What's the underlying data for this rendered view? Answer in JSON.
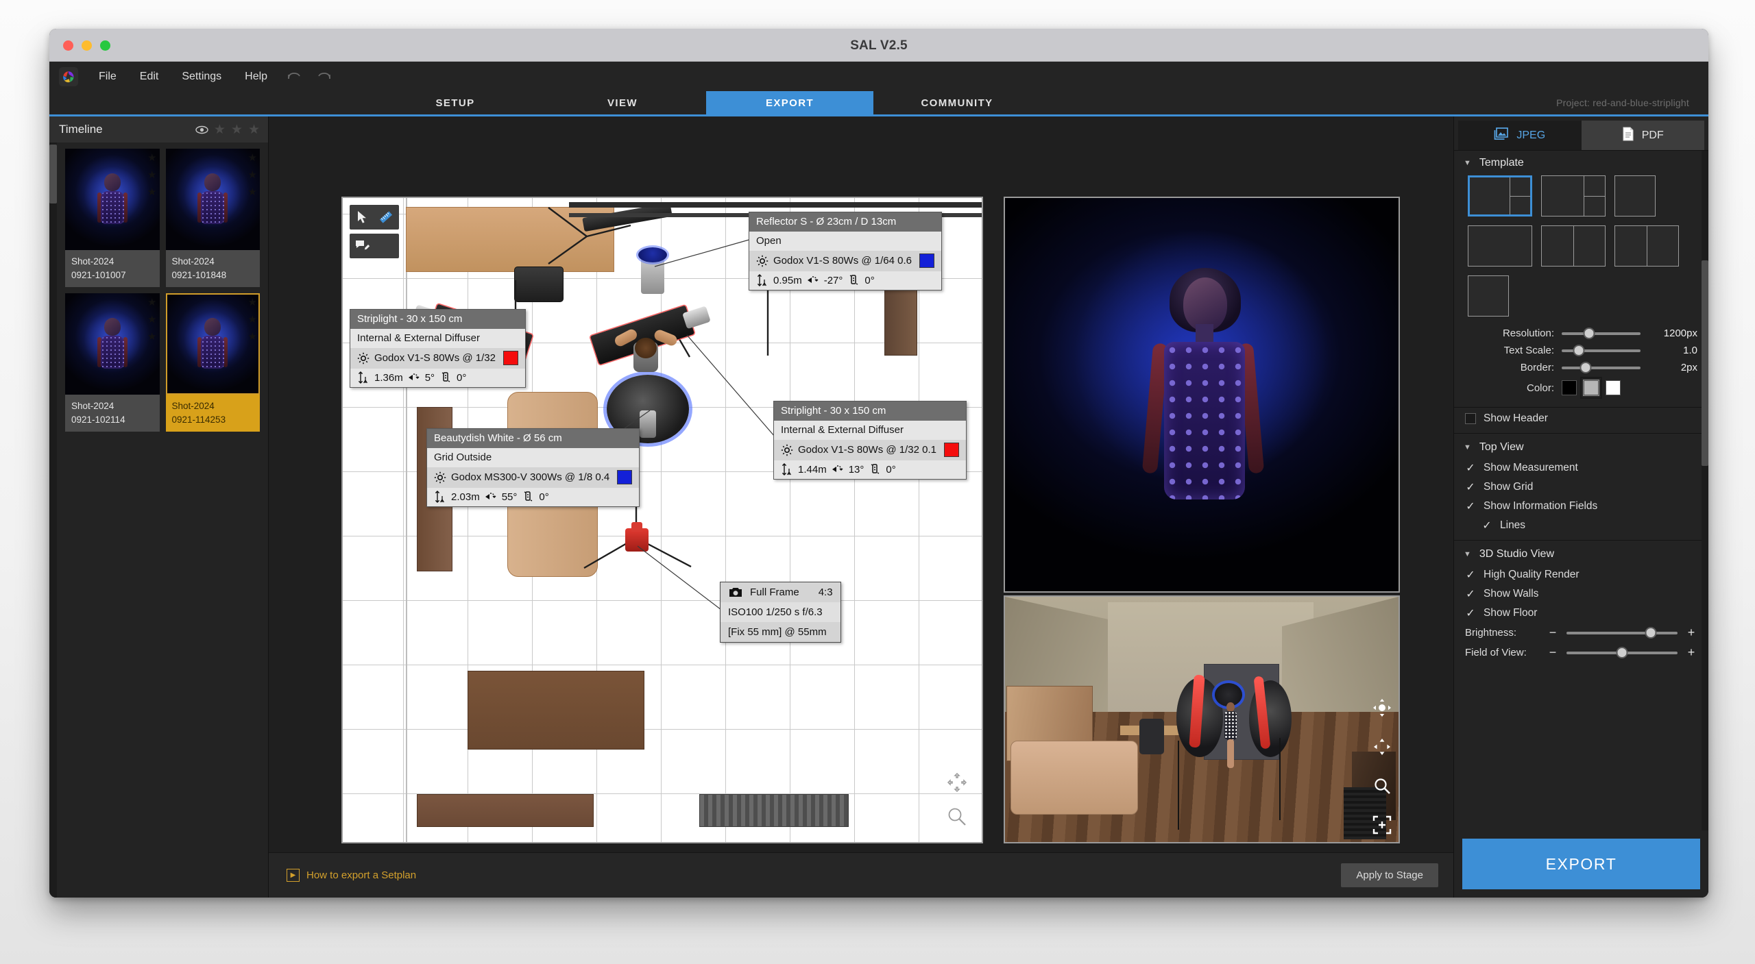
{
  "window": {
    "title": "SAL V2.5"
  },
  "menubar": {
    "items": [
      "File",
      "Edit",
      "Settings",
      "Help"
    ],
    "undo_icon": "undo-icon",
    "redo_icon": "redo-icon",
    "logo_icon": "app-logo-icon"
  },
  "nav": {
    "tabs": [
      {
        "label": "SETUP",
        "active": false
      },
      {
        "label": "VIEW",
        "active": false
      },
      {
        "label": "EXPORT",
        "active": true
      },
      {
        "label": "COMMUNITY",
        "active": false
      }
    ],
    "project_label": "Project: red-and-blue-striplight",
    "accent": "#3d8fd6"
  },
  "timeline": {
    "title": "Timeline",
    "eye_icon": "eye-icon",
    "stars": [
      "star-icon",
      "star-icon",
      "star-icon"
    ],
    "shots": [
      {
        "name": "Shot-2024",
        "id": "0921-101007",
        "selected": false
      },
      {
        "name": "Shot-2024",
        "id": "0921-101848",
        "selected": false
      },
      {
        "name": "Shot-2024",
        "id": "0921-102114",
        "selected": false
      },
      {
        "name": "Shot-2024",
        "id": "0921-114253",
        "selected": true
      }
    ],
    "selected_color": "#d8a11a"
  },
  "topview": {
    "tools": [
      {
        "name": "pointer-tool",
        "icon": "cursor-icon"
      },
      {
        "name": "measure-tool",
        "icon": "ruler-icon"
      },
      {
        "name": "annotate-tool",
        "icon": "comment-pencil-icon"
      }
    ],
    "nav_icons": [
      "pan-icon",
      "zoom-icon"
    ],
    "callouts": [
      {
        "id": "reflector",
        "title": "Reflector S - Ø 23cm / D 13cm",
        "subtitle": "Open",
        "light": "Godox V1-S 80Ws  @ 1/64 0.6",
        "swatch": "#1320d8",
        "height": "0.95m",
        "tilt": "-27°",
        "rotation": "0°"
      },
      {
        "id": "striplight-left",
        "title": "Striplight - 30 x 150 cm",
        "subtitle": "Internal & External Diffuser",
        "light": "Godox V1-S 80Ws @ 1/32",
        "swatch": "#f40d0d",
        "height": "1.36m",
        "tilt": "5°",
        "rotation": "0°"
      },
      {
        "id": "beautydish",
        "title": "Beautydish White - Ø 56 cm",
        "subtitle": "Grid Outside",
        "light": "Godox MS300-V 300Ws @ 1/8 0.4",
        "swatch": "#1320d8",
        "height": "2.03m",
        "tilt": "55°",
        "rotation": "0°"
      },
      {
        "id": "striplight-right",
        "title": "Striplight - 30 x 150 cm",
        "subtitle": "Internal & External Diffuser",
        "light": "Godox V1-S 80Ws @ 1/32 0.1",
        "swatch": "#f40d0d",
        "height": "1.44m",
        "tilt": "13°",
        "rotation": "0°"
      }
    ],
    "camera": {
      "icon": "camera-icon",
      "sensor": "Full Frame",
      "aspect": "4:3",
      "exposure": "ISO100 1/250 s f/6.3",
      "lens": "[Fix 55 mm] @  55mm"
    }
  },
  "preview3d": {
    "nav_icons": [
      "orbit-icon",
      "pan-icon",
      "zoom-icon",
      "fit-icon"
    ]
  },
  "bottom": {
    "howto_icon": "play-icon",
    "howto_label": "How to export a Setplan",
    "apply_label": "Apply to Stage"
  },
  "right": {
    "format_tabs": [
      {
        "label": "JPEG",
        "icon": "image-icon",
        "active": true
      },
      {
        "label": "PDF",
        "icon": "document-icon",
        "active": false
      }
    ],
    "template": {
      "title": "Template",
      "options": [
        {
          "id": "t1",
          "kind": "split-left-two-right",
          "selected": true
        },
        {
          "id": "t2",
          "kind": "split-left-two-right",
          "selected": false
        },
        {
          "id": "t3",
          "kind": "square",
          "selected": false
        },
        {
          "id": "t4",
          "kind": "single",
          "selected": false
        },
        {
          "id": "t5",
          "kind": "two-cols",
          "selected": false
        },
        {
          "id": "t6",
          "kind": "two-cols",
          "selected": false
        },
        {
          "id": "t7",
          "kind": "square",
          "selected": false
        }
      ]
    },
    "sliders": [
      {
        "label": "Resolution:",
        "value": "1200px",
        "pct": 35
      },
      {
        "label": "Text Scale:",
        "value": "1.0",
        "pct": 22
      },
      {
        "label": "Border:",
        "value": "2px",
        "pct": 30
      }
    ],
    "color": {
      "label": "Color:",
      "swatches": [
        "#000000",
        "#b6b6b6",
        "#ffffff"
      ],
      "selected_index": 1
    },
    "show_header": {
      "label": "Show Header",
      "checked": false
    },
    "top_view": {
      "title": "Top View",
      "items": [
        {
          "label": "Show Measurement",
          "checked": true,
          "indent": false
        },
        {
          "label": "Show Grid",
          "checked": true,
          "indent": false
        },
        {
          "label": "Show Information Fields",
          "checked": true,
          "indent": false
        },
        {
          "label": "Lines",
          "checked": true,
          "indent": true
        }
      ]
    },
    "studio_view": {
      "title": "3D Studio View",
      "items": [
        {
          "label": "High Quality Render",
          "checked": true,
          "indent": false
        },
        {
          "label": "Show Walls",
          "checked": true,
          "indent": false
        },
        {
          "label": "Show Floor",
          "checked": true,
          "indent": false
        }
      ],
      "sliders": [
        {
          "label": "Brightness:",
          "minus": "−",
          "plus": "+",
          "pct": 76
        },
        {
          "label": "Field of View:",
          "minus": "−",
          "plus": "+",
          "pct": 50
        }
      ]
    },
    "export_button": "EXPORT"
  }
}
